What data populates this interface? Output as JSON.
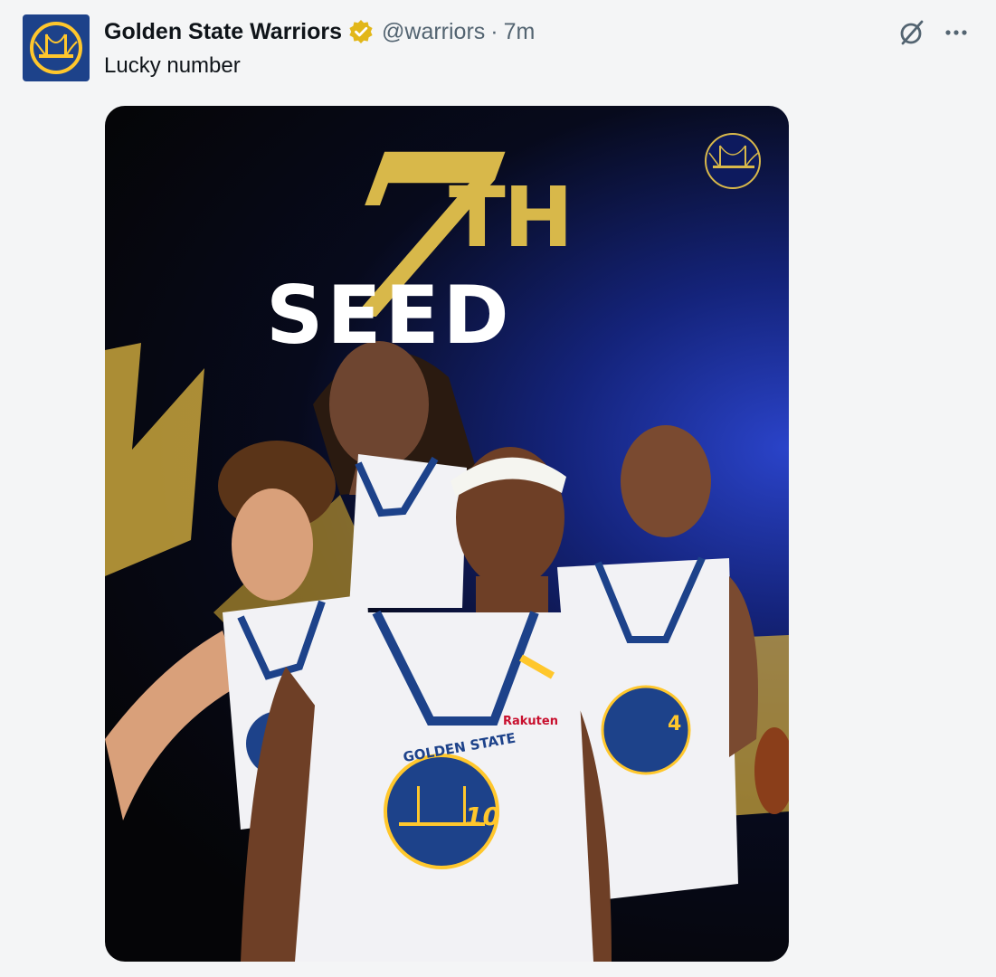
{
  "tweet": {
    "display_name": "Golden State Warriors",
    "handle": "@warriors",
    "separator": "·",
    "time": "7m",
    "text": "Lucky number"
  },
  "icons": {
    "avatar": "warriors-bridge-logo",
    "verified": "gold-verified-badge-icon",
    "grok": "grok-icon",
    "more": "more-options-icon"
  },
  "colors": {
    "warriors_blue": "#1d428a",
    "warriors_gold": "#ffc72c",
    "verified_gold": "#e2b719",
    "text_primary": "#0f1419",
    "text_secondary": "#536471"
  },
  "media": {
    "headline_number": "7",
    "headline_suffix": "TH",
    "headline_word": "SEED",
    "jersey_numbers": [
      "10",
      "4"
    ],
    "jersey_text": "GOLDEN STATE",
    "sponsor": "Rakuten"
  }
}
